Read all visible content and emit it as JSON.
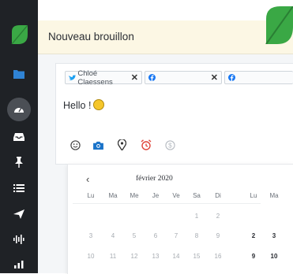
{
  "header": {
    "title": "Nouveau brouillon"
  },
  "sidebar": {
    "icons": [
      "folder-icon",
      "dashboard-icon",
      "inbox-icon",
      "pin-icon",
      "list-icon",
      "send-icon",
      "waveform-icon",
      "bar-chart-icon"
    ]
  },
  "composer": {
    "accounts": [
      {
        "name": "Chloé Claessens",
        "network": "twitter",
        "remove": "✕"
      },
      {
        "name": "",
        "network": "facebook",
        "remove": "✕"
      },
      {
        "name": "",
        "network": "facebook"
      }
    ],
    "message": "Hello !",
    "toolbar": [
      "emoji-icon",
      "camera-icon",
      "location-icon",
      "alarm-icon",
      "dollar-icon"
    ]
  },
  "datepicker": {
    "prev": "‹",
    "month_label": "février 2020",
    "weekdays_left": [
      "Lu",
      "Ma",
      "Me",
      "Je",
      "Ve",
      "Sa",
      "Di"
    ],
    "weekdays_right": [
      "Lu",
      "Ma"
    ],
    "row1_left": [
      "",
      "",
      "",
      "",
      "",
      "1",
      "2"
    ],
    "row2_left": [
      "3",
      "4",
      "5",
      "6",
      "7",
      "8",
      "9"
    ],
    "row3_left": [
      "10",
      "11",
      "12",
      "13",
      "14",
      "15",
      "16"
    ],
    "row2_right": [
      "2",
      "3"
    ],
    "row3_right": [
      "9",
      "10"
    ]
  },
  "colors": {
    "sidebar": "#1f2226",
    "header_bg": "#fcf7e4",
    "brand_green": "#3aa845",
    "twitter": "#1da1f2",
    "facebook": "#1877f2",
    "camera": "#1a73c9",
    "alarm": "#e0453a"
  }
}
